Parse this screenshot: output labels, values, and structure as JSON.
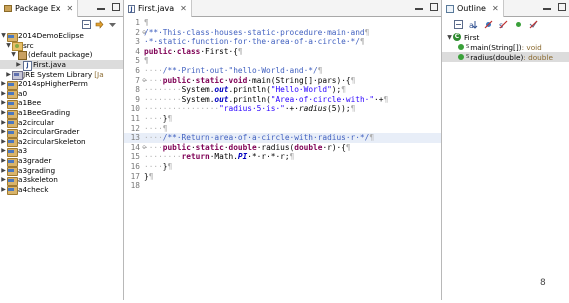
{
  "package_explorer": {
    "tab_label": "Package Ex",
    "tab_close": "✕",
    "tree": [
      {
        "arrow": "▼",
        "icon": "proj",
        "label": "2014DemoEclipse",
        "indent": 0
      },
      {
        "arrow": "▼",
        "icon": "srcf",
        "label": "src",
        "indent": 1
      },
      {
        "arrow": "▼",
        "icon": "pkg",
        "label": "(default package)",
        "indent": 2
      },
      {
        "arrow": "▶",
        "icon": "jfile",
        "label": "First.java",
        "indent": 3,
        "selected": true
      },
      {
        "arrow": "▶",
        "icon": "lib",
        "label": "JRE System Library",
        "suffix": "[Ja",
        "indent": 1
      },
      {
        "arrow": "▶",
        "icon": "proj",
        "label": "2014spHigherPerm",
        "indent": 0
      },
      {
        "arrow": "▶",
        "icon": "proj",
        "label": "a0",
        "indent": 0
      },
      {
        "arrow": "▶",
        "icon": "proj",
        "label": "a1Bee",
        "indent": 0
      },
      {
        "arrow": "▶",
        "icon": "proj",
        "label": "a1BeeGrading",
        "indent": 0
      },
      {
        "arrow": "▶",
        "icon": "proj",
        "label": "a2circular",
        "indent": 0
      },
      {
        "arrow": "▶",
        "icon": "proj",
        "label": "a2circularGrader",
        "indent": 0
      },
      {
        "arrow": "▶",
        "icon": "proj",
        "label": "a2circularSkeleton",
        "indent": 0
      },
      {
        "arrow": "▶",
        "icon": "proj",
        "label": "a3",
        "indent": 0
      },
      {
        "arrow": "▶",
        "icon": "proj",
        "label": "a3grader",
        "indent": 0
      },
      {
        "arrow": "▶",
        "icon": "proj",
        "label": "a3grading",
        "indent": 0
      },
      {
        "arrow": "▶",
        "icon": "proj",
        "label": "a3skeleton",
        "indent": 0
      },
      {
        "arrow": "▶",
        "icon": "proj",
        "label": "a4check",
        "indent": 0
      }
    ]
  },
  "editor": {
    "tab_label": "First.java",
    "tab_close": "✕",
    "lines": [
      {
        "n": "1",
        "html": "<span class=\"ws\">¶</span>"
      },
      {
        "n": "2",
        "fold": "⊖",
        "html": "<span class=\"cm\">/**·This·class·houses·static·procedure·main·and</span><span class=\"ws\">¶</span>"
      },
      {
        "n": "3",
        "html": "<span class=\"cm\">·*·static·function·for·the·area·of·a·circle·*/</span><span class=\"ws\">¶</span>"
      },
      {
        "n": "4",
        "html": "<span class=\"kw\">public</span>·<span class=\"kw\">class</span>·First·{<span class=\"ws\">¶</span>"
      },
      {
        "n": "5",
        "html": "<span class=\"ws\">¶</span>"
      },
      {
        "n": "6",
        "html": "<span class=\"ws\">····</span><span class=\"cm\">/**·Print·out·\"hello·World·and·*/</span><span class=\"ws\">¶</span>"
      },
      {
        "n": "7",
        "fold": "⊖",
        "html": "<span class=\"ws\">····</span><span class=\"kw\">public</span>·<span class=\"kw\">static</span>·<span class=\"kw\">void</span>·main(String[]·pars)·{<span class=\"ws\">¶</span>"
      },
      {
        "n": "8",
        "html": "<span class=\"ws\">········</span>System.<span class=\"sf\">out</span>.println(<span class=\"str\">\"Hello·World\"</span>);<span class=\"ws\">¶</span>"
      },
      {
        "n": "9",
        "html": "<span class=\"ws\">········</span>System.<span class=\"sf\">out</span>.println(<span class=\"str\">\"Area·of·circle·with·\"</span>·+<span class=\"ws\">¶</span>"
      },
      {
        "n": "10",
        "html": "<span class=\"ws\">················</span><span class=\"str\">\"radius·5·is·\"</span>·+·<span class=\"it\">radius</span>(5));<span class=\"ws\">¶</span>"
      },
      {
        "n": "11",
        "html": "<span class=\"ws\">····</span>}<span class=\"ws\">¶</span>"
      },
      {
        "n": "12",
        "html": "<span class=\"ws\">····¶</span>"
      },
      {
        "n": "13",
        "hl": true,
        "html": "<span class=\"ws\">····</span><span class=\"cm\">/**·Return·area·of·a·circle·with·radius·r·*/</span><span class=\"ws\">¶</span>"
      },
      {
        "n": "14",
        "fold": "⊖",
        "html": "<span class=\"ws\">····</span><span class=\"kw\">public</span>·<span class=\"kw\">static</span>·<span class=\"kw\">double</span>·radius(<span class=\"kw\">double</span>·r)·{<span class=\"ws\">¶</span>"
      },
      {
        "n": "15",
        "html": "<span class=\"ws\">········</span><span class=\"kw\">return</span>·Math.<span class=\"sf\">PI</span>·*·r·*·r;<span class=\"ws\">¶</span>"
      },
      {
        "n": "16",
        "html": "<span class=\"ws\">····</span>}<span class=\"ws\">¶</span>"
      },
      {
        "n": "17",
        "html": "}<span class=\"ws\">¶</span>"
      },
      {
        "n": "18",
        "html": ""
      }
    ]
  },
  "outline": {
    "tab_label": "Outline",
    "tab_close": "✕",
    "class_name": "First",
    "methods": [
      {
        "sup": "S",
        "name": "main(String[])",
        "ret": " : void",
        "selected": false
      },
      {
        "sup": "S",
        "name": "radius(double)",
        "ret": " : double",
        "selected": true
      }
    ]
  },
  "page_number": "8"
}
